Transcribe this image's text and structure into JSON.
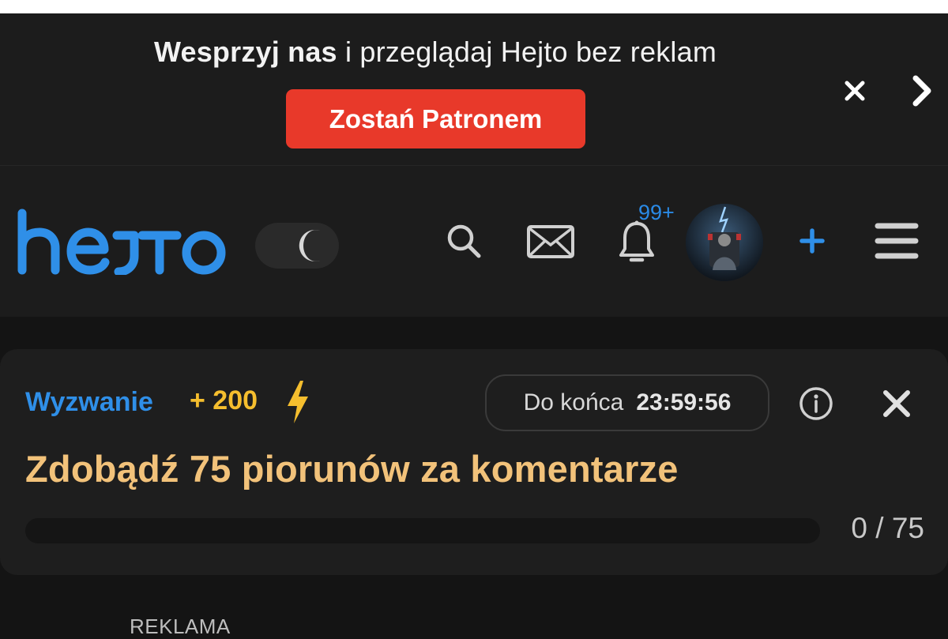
{
  "banner": {
    "text_bold": "Wesprzyj nas",
    "text_rest": " i przeglądaj Hejto bez reklam",
    "button_label": "Zostań Patronem",
    "close_icon": "close-icon",
    "next_icon": "chevron-right-icon"
  },
  "header": {
    "logo_text": "hejto",
    "theme_toggle": "dark-mode",
    "notifications_badge": "99+",
    "icons": [
      "search-icon",
      "mail-icon",
      "bell-icon",
      "plus-icon",
      "menu-icon"
    ]
  },
  "challenge": {
    "label": "Wyzwanie",
    "points": "+ 200",
    "timer_label": "Do końca",
    "timer_value": "23:59:56",
    "title": "Zdobądź 75 piorunów za komentarze",
    "progress_text": "0 / 75",
    "progress_fraction": 0
  },
  "ad": {
    "label": "REKLAMA"
  },
  "colors": {
    "accent_blue": "#2f8fe8",
    "patron_red": "#e8392a",
    "points_yellow": "#f5be2e",
    "title_gold": "#f2c27a"
  }
}
